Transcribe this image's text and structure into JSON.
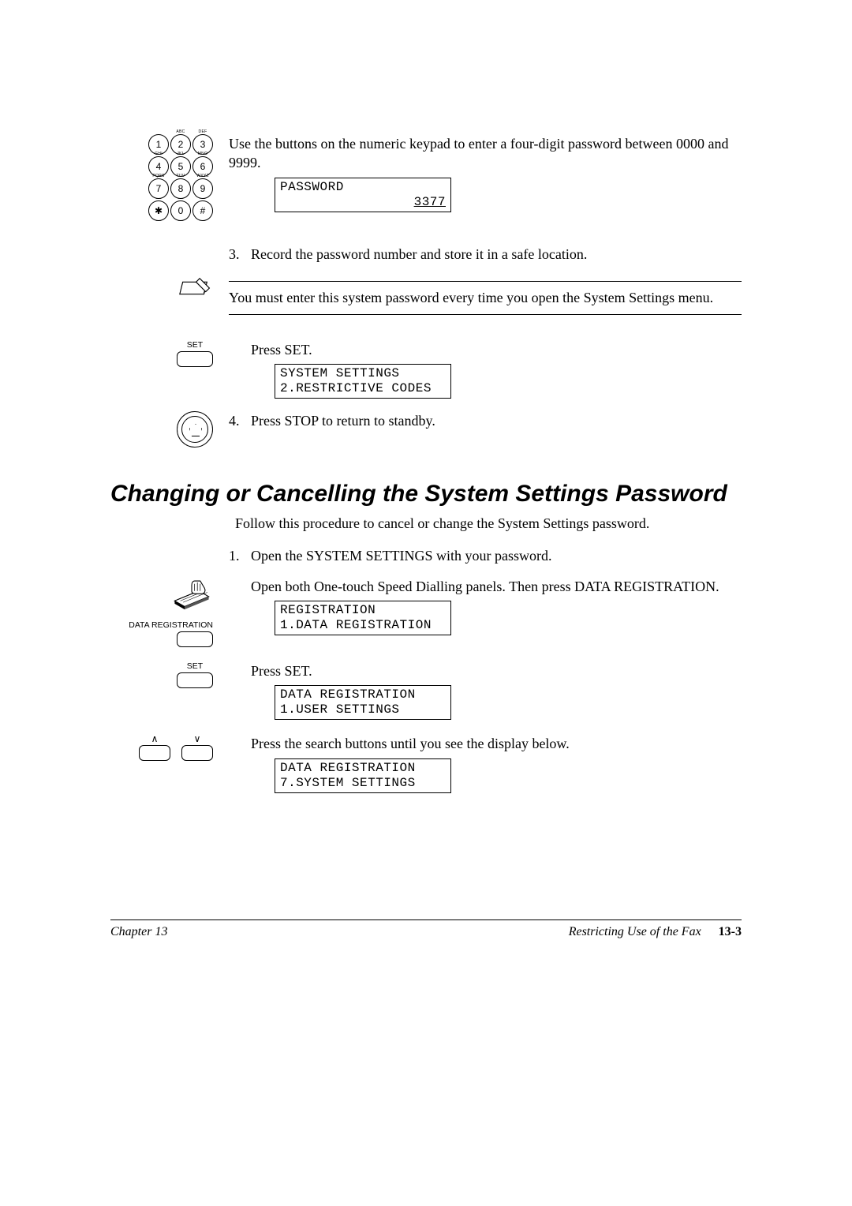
{
  "keypad_letters": [
    "",
    "ABC",
    "DEF",
    "GHI",
    "JKL",
    "MNO",
    "PQRS",
    "TUV",
    "WXYZ"
  ],
  "step2": {
    "text": "Use the buttons on the numeric keypad to enter a four-digit password between 0000 and 9999.",
    "lcd_line1": "PASSWORD",
    "lcd_line2": "3377"
  },
  "step3": {
    "num": "3.",
    "text": "Record the password number and store it in a safe location."
  },
  "note": {
    "text": "You must enter this system password every time you open the System Settings menu."
  },
  "set1": {
    "label": "SET",
    "text": "Press SET.",
    "lcd_line1": "SYSTEM SETTINGS",
    "lcd_line2": " 2.RESTRICTIVE CODES"
  },
  "step4": {
    "num": "4.",
    "text": "Press STOP to return to standby."
  },
  "heading": "Changing or Cancelling the System Settings Password",
  "intro": "Follow this procedure to cancel or change the System Settings password.",
  "b_step1": {
    "num": "1.",
    "text": "Open the SYSTEM SETTINGS with your password."
  },
  "b_reg": {
    "label": "DATA REGISTRATION",
    "text": "Open both One-touch Speed Dialling panels. Then press DATA REGISTRATION.",
    "lcd_line1": "REGISTRATION",
    "lcd_line2": " 1.DATA REGISTRATION"
  },
  "b_set": {
    "label": "SET",
    "text": "Press SET.",
    "lcd_line1": "DATA REGISTRATION",
    "lcd_line2": " 1.USER SETTINGS"
  },
  "b_search": {
    "up": "∧",
    "down": "∨",
    "text": "Press the search buttons until you see the display below.",
    "lcd_line1": "DATA REGISTRATION",
    "lcd_line2": " 7.SYSTEM SETTINGS"
  },
  "footer": {
    "left": "Chapter 13",
    "right": "Restricting Use of the Fax",
    "page": "13-3"
  }
}
